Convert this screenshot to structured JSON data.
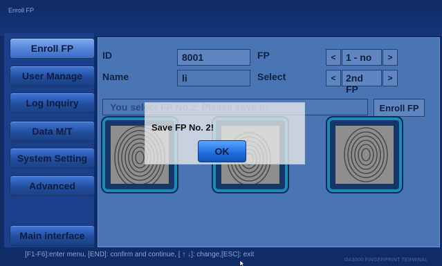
{
  "window": {
    "title": "Enroll FP"
  },
  "sidebar": {
    "items": [
      {
        "label": "Enroll FP",
        "active": true
      },
      {
        "label": "User Manage"
      },
      {
        "label": "Log Inquiry"
      },
      {
        "label": "Data M/T"
      },
      {
        "label": "System Setting"
      },
      {
        "label": "Advanced"
      }
    ],
    "main_interface": "Main interface"
  },
  "form": {
    "id_label": "ID",
    "id_value": "8001",
    "name_label": "Name",
    "name_value": "li",
    "fp_label": "FP",
    "fp_value": "1 - no",
    "select_label": "Select",
    "select_value": "2nd FP",
    "prev_glyph": "<",
    "next_glyph": ">"
  },
  "status_message": "You select FP No.2. Please save it!",
  "enroll_button": "Enroll FP",
  "dialog": {
    "message": "Save FP No. 2!",
    "ok_label": "OK"
  },
  "footer": {
    "hint": "[F1-F6]:enter menu, [END]: confirm and continue, [ ↑ ↓]: change,[ESC]: exit",
    "brand": "OA3000 FINGERPRINT TERMINAL"
  },
  "colors": {
    "background": "#0f2c66",
    "panel": "#4a75b5",
    "accent": "#1d89b6"
  }
}
